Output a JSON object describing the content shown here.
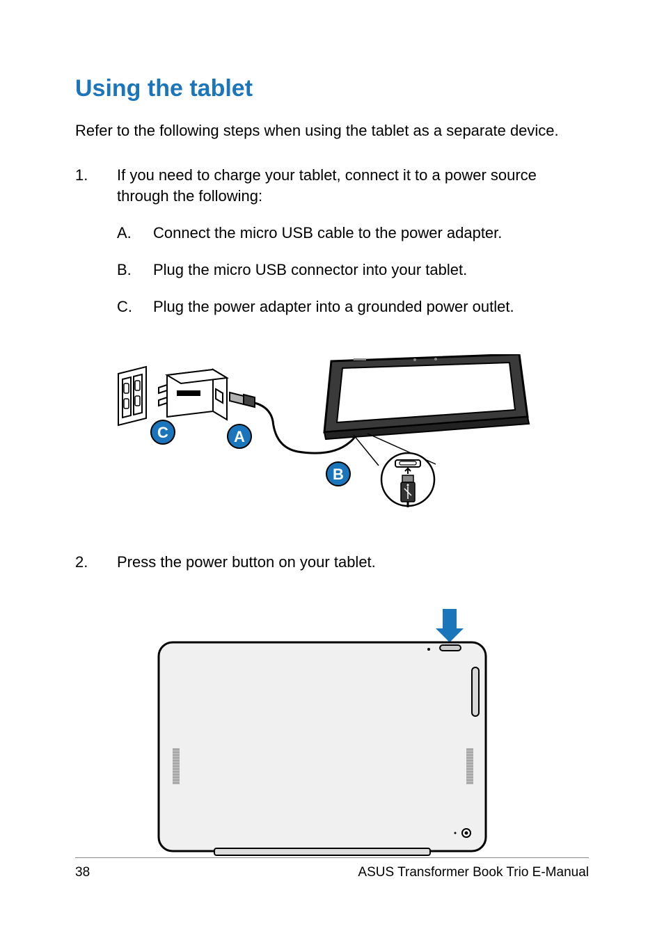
{
  "heading": "Using the tablet",
  "intro": "Refer to the following steps when using the tablet as a separate device.",
  "steps": [
    {
      "num": "1.",
      "text": "If you need to charge your tablet, connect it to a power source through the following:",
      "subs": [
        {
          "letter": "A.",
          "text": "Connect the micro USB cable to the power adapter."
        },
        {
          "letter": "B.",
          "text": "Plug the micro USB connector into your tablet."
        },
        {
          "letter": "C.",
          "text": "Plug the power adapter into a grounded power outlet."
        }
      ]
    },
    {
      "num": "2.",
      "text": "Press the power button on your tablet."
    }
  ],
  "callouts": {
    "a": "A",
    "b": "B",
    "c": "C"
  },
  "footer": {
    "page": "38",
    "title": "ASUS Transformer Book Trio E-Manual"
  },
  "colors": {
    "accent": "#1b75bb"
  }
}
